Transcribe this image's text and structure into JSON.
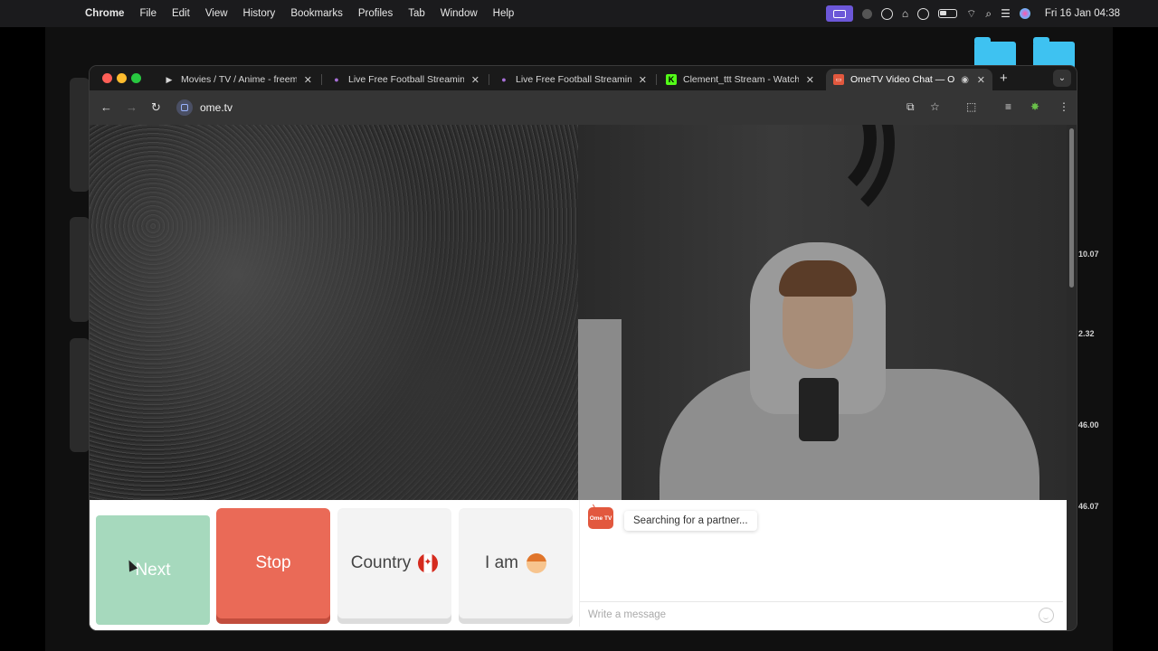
{
  "menubar": {
    "apple": "",
    "app": "Chrome",
    "items": [
      "File",
      "Edit",
      "View",
      "History",
      "Bookmarks",
      "Profiles",
      "Tab",
      "Window",
      "Help"
    ],
    "clock": "Fri 16 Jan  04:38"
  },
  "desktop": {
    "values": [
      "10.07",
      "2.32",
      "46.00",
      "46.07"
    ]
  },
  "browser": {
    "tabs": [
      {
        "title": "Movies / TV / Anime - freeme",
        "icon": "play-icon"
      },
      {
        "title": "Live Free Football Streaming",
        "icon": "football-icon"
      },
      {
        "title": "Live Free Football Streaming",
        "icon": "football-icon"
      },
      {
        "title": "Clement_ttt Stream - Watch",
        "icon": "kick-icon"
      },
      {
        "title": "OmeTV Video Chat — Or",
        "icon": "ometv-icon",
        "active": true
      }
    ],
    "new_tab": "+",
    "url": "ome.tv"
  },
  "ometv": {
    "next_label": "Next",
    "stop_label": "Stop",
    "country_label": "Country",
    "iam_label": "I am",
    "logo_text": "Ome TV",
    "status_message": "Searching for a partner...",
    "message_placeholder": "Write a message"
  },
  "colors": {
    "next": "#a6d9bd",
    "stop": "#ea6a57",
    "accent_menubar": "#6c57d8"
  }
}
